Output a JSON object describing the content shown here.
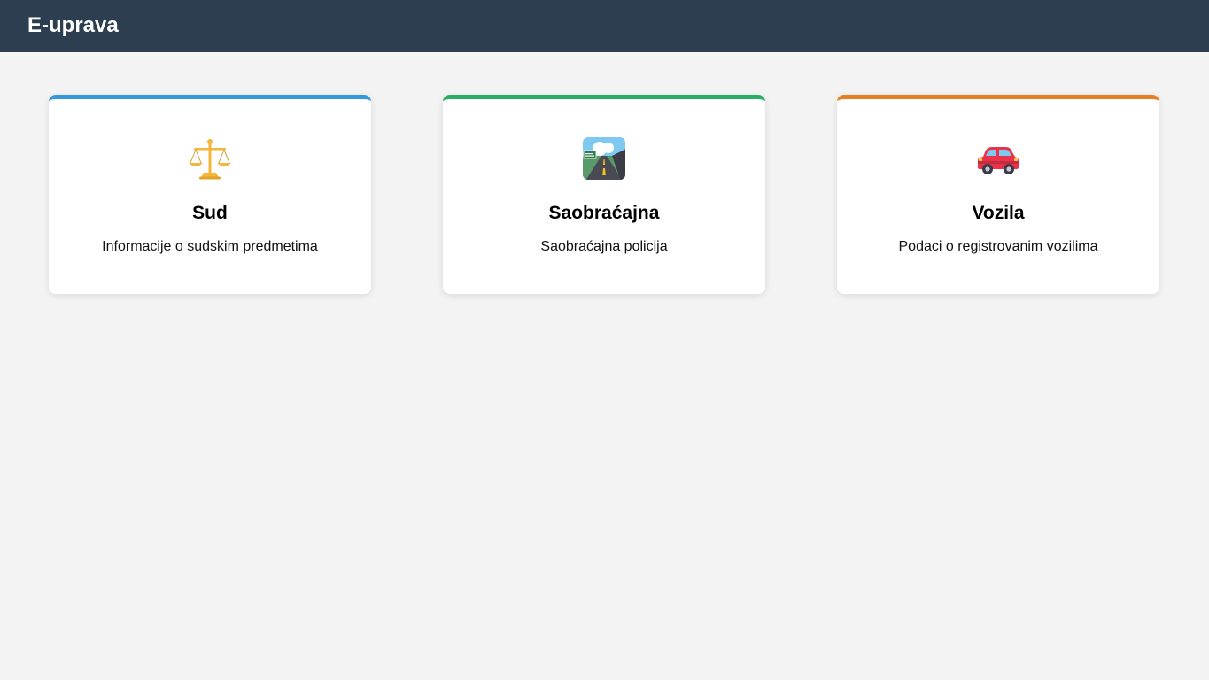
{
  "header": {
    "title": "E-uprava",
    "background": "#2c3e50"
  },
  "cards": [
    {
      "title": "Sud",
      "description": "Informacije o sudskim predmetima",
      "icon": "balance-scale-icon",
      "accent": "#3498db"
    },
    {
      "title": "Saobraćajna",
      "description": "Saobraćajna policija",
      "icon": "motorway-icon",
      "accent": "#27ae60"
    },
    {
      "title": "Vozila",
      "description": "Podaci o registrovanim vozilima",
      "icon": "car-icon",
      "accent": "#e67e22"
    }
  ]
}
